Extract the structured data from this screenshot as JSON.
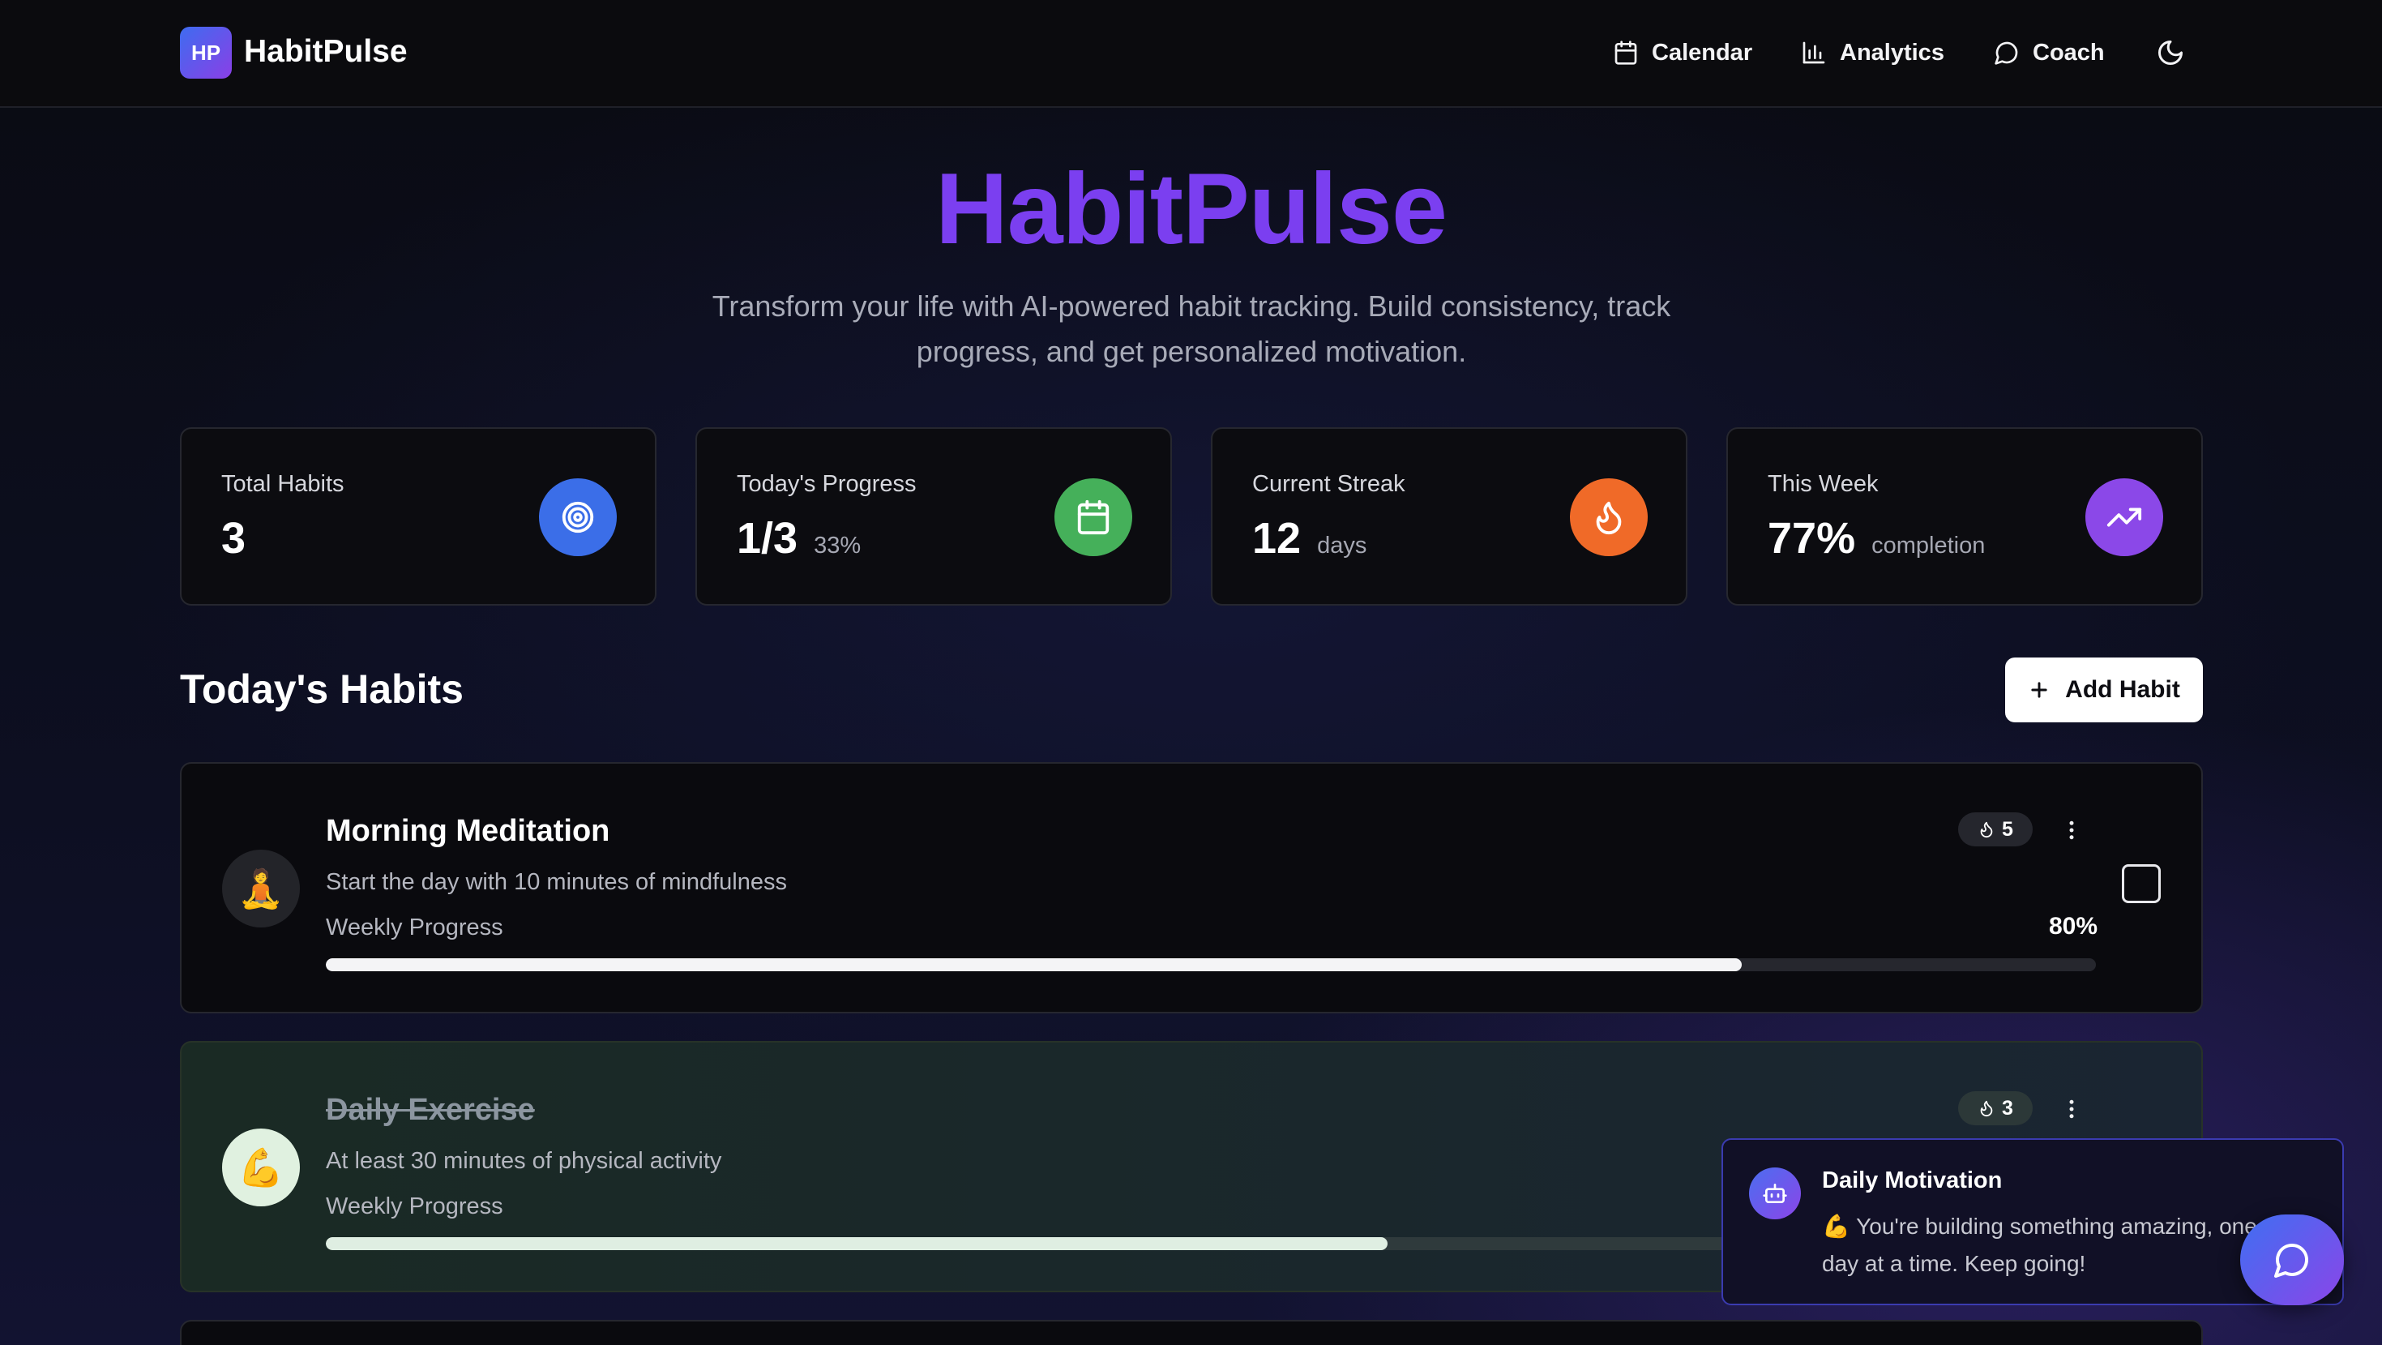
{
  "nav": {
    "logo_initials": "HP",
    "brand": "HabitPulse",
    "items": [
      {
        "label": "Calendar",
        "icon": "calendar-icon"
      },
      {
        "label": "Analytics",
        "icon": "bar-chart-icon"
      },
      {
        "label": "Coach",
        "icon": "chat-bubble-icon"
      }
    ],
    "theme_icon": "moon-icon"
  },
  "hero": {
    "title": "HabitPulse",
    "subtitle": "Transform your life with AI-powered habit tracking. Build consistency, track progress, and get personalized motivation."
  },
  "stats": [
    {
      "label": "Total Habits",
      "value": "3",
      "unit": "",
      "icon": "target-icon",
      "color": "#3b6ee8"
    },
    {
      "label": "Today's Progress",
      "value": "1/3",
      "unit": "33%",
      "icon": "calendar-icon",
      "color": "#45b05a"
    },
    {
      "label": "Current Streak",
      "value": "12",
      "unit": "days",
      "icon": "flame-icon",
      "color": "#f06a28"
    },
    {
      "label": "This Week",
      "value": "77%",
      "unit": "completion",
      "icon": "trending-up-icon",
      "color": "#8b48e8"
    }
  ],
  "section": {
    "title": "Today's Habits",
    "add_button": "Add Habit"
  },
  "habits": [
    {
      "emoji": "🧘",
      "name": "Morning Meditation",
      "description": "Start the day with 10 minutes of mindfulness",
      "progress_label": "Weekly Progress",
      "progress_text": "80%",
      "progress": 0.8,
      "streak": "5",
      "completed": false
    },
    {
      "emoji": "💪",
      "name": "Daily Exercise",
      "description": "At least 30 minutes of physical activity",
      "progress_label": "Weekly Progress",
      "progress": 0.6,
      "streak": "3",
      "completed": true
    }
  ],
  "toast": {
    "title": "Daily Motivation",
    "text": "💪 You're building something amazing, one day at a time. Keep going!"
  },
  "colors": {
    "accent": "#7b3ff0",
    "background": "#0b0b0e"
  }
}
